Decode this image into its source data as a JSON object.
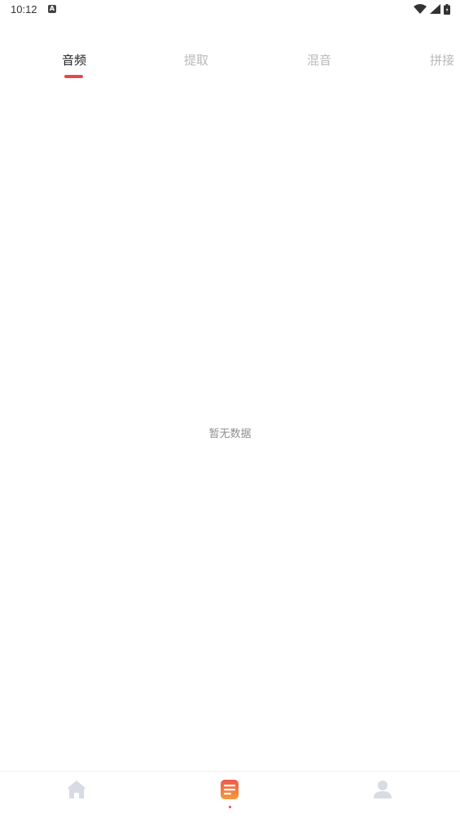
{
  "status_bar": {
    "time": "10:12",
    "notification_icon": "A"
  },
  "tabs": [
    {
      "label": "音频",
      "active": true
    },
    {
      "label": "提取",
      "active": false
    },
    {
      "label": "混音",
      "active": false
    },
    {
      "label": "拼接",
      "active": false
    }
  ],
  "main": {
    "empty_text": "暂无数据"
  },
  "bottom_nav": {
    "items": [
      "home-icon",
      "document-icon",
      "user-icon"
    ],
    "accent_color": "#e8474a",
    "inactive_color": "#d8dbe3"
  },
  "colors": {
    "accent": "#e8474a",
    "tab_inactive": "#b8b8b8",
    "tab_active": "#222222"
  }
}
